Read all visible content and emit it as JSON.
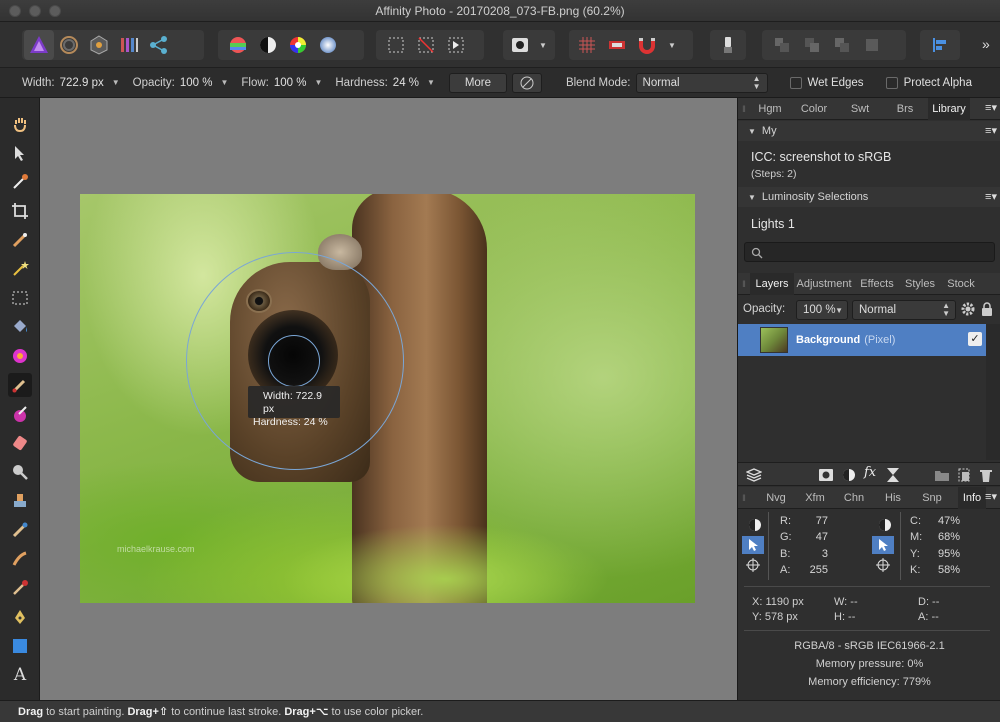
{
  "window": {
    "title": "Affinity Photo - 20170208_073-FB.png (60.2%)"
  },
  "context": {
    "width_label": "Width:",
    "width_value": "722.9 px",
    "opacity_label": "Opacity:",
    "opacity_value": "100 %",
    "flow_label": "Flow:",
    "flow_value": "100 %",
    "hardness_label": "Hardness:",
    "hardness_value": "24 %",
    "more_label": "More",
    "blend_label": "Blend Mode:",
    "blend_value": "Normal",
    "wet_edges_label": "Wet Edges",
    "protect_alpha_label": "Protect Alpha"
  },
  "canvas": {
    "watermark": "michaelkrause.com",
    "tooltip_width": "Width: 722.9 px",
    "tooltip_hardness": "Hardness: 24 %"
  },
  "top_tabs": [
    "Hgm",
    "Color",
    "Swt",
    "Brs",
    "Library"
  ],
  "library": {
    "section_my": "My",
    "macro_name": "ICC: screenshot to sRGB",
    "macro_steps": "(Steps: 2)",
    "section_luminosity": "Luminosity Selections",
    "lights_item": "Lights 1"
  },
  "layer_tabs": [
    "Layers",
    "Adjustment",
    "Effects",
    "Styles",
    "Stock"
  ],
  "layers": {
    "opacity_label": "Opacity:",
    "opacity_value": "100 %",
    "blend_value": "Normal",
    "layer_name": "Background",
    "layer_type": "(Pixel)"
  },
  "info_tabs": [
    "Nvg",
    "Xfm",
    "Chn",
    "His",
    "Snp",
    "Info"
  ],
  "info": {
    "rgba": [
      {
        "label": "R:",
        "value": "77"
      },
      {
        "label": "G:",
        "value": "47"
      },
      {
        "label": "B:",
        "value": "3"
      },
      {
        "label": "A:",
        "value": "255"
      }
    ],
    "cmyk": [
      {
        "label": "C:",
        "value": "47%"
      },
      {
        "label": "M:",
        "value": "68%"
      },
      {
        "label": "Y:",
        "value": "95%"
      },
      {
        "label": "K:",
        "value": "58%"
      }
    ],
    "x": "X: 1190 px",
    "y": "Y: 578 px",
    "w": "W: --",
    "h": "H: --",
    "d": "D: --",
    "a": "A: --",
    "format": "RGBA/8 - sRGB IEC61966-2.1",
    "memory_pressure": "Memory pressure: 0%",
    "memory_efficiency": "Memory efficiency: 779%"
  },
  "status": {
    "b1": "Drag",
    "t1": " to start painting. ",
    "b2": "Drag+⇧",
    "t2": " to continue last stroke. ",
    "b3": "Drag+⌥",
    "t3": " to use color picker."
  },
  "colors": {
    "accent": "#4f7fc3",
    "brush_ring": "#7aa6d6"
  }
}
